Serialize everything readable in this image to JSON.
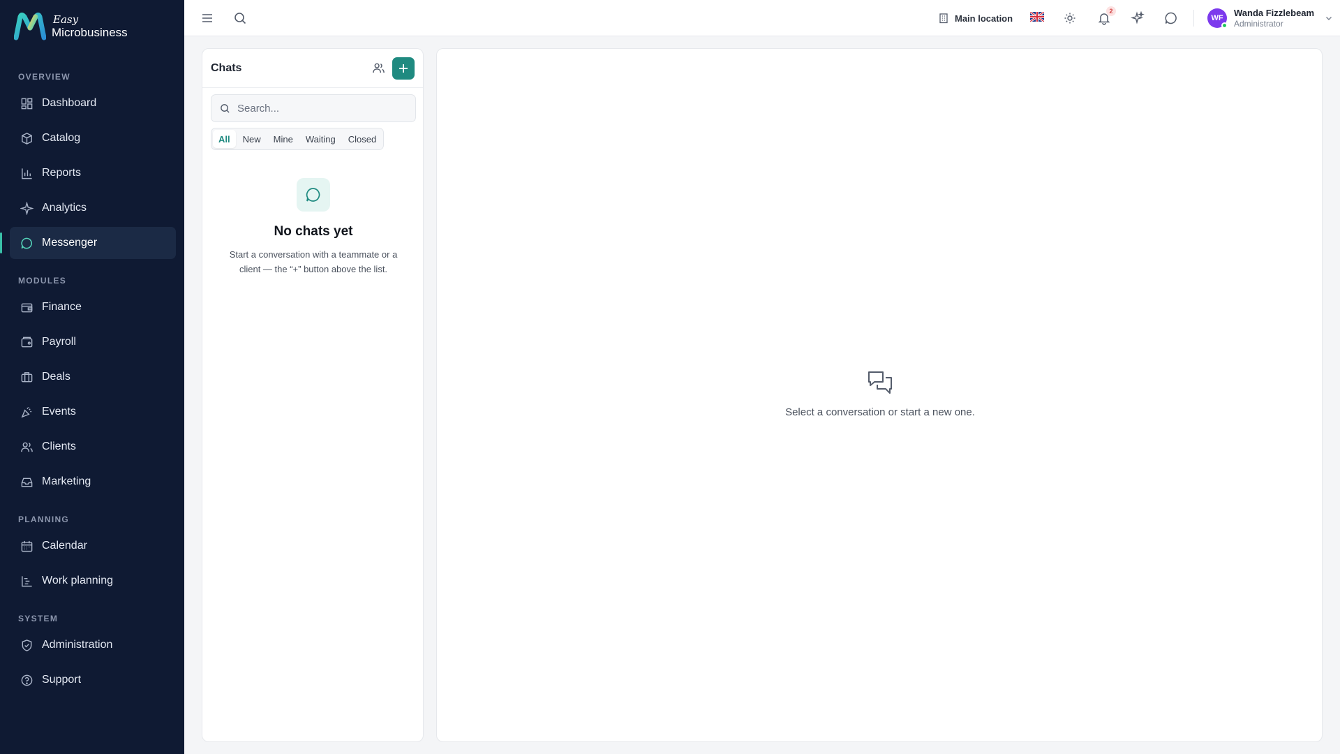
{
  "brand": {
    "easy": "Easy",
    "name": "Microbusiness"
  },
  "sidebar": {
    "sections": [
      {
        "label": "OVERVIEW"
      },
      {
        "label": "MODULES"
      },
      {
        "label": "PLANNING"
      },
      {
        "label": "SYSTEM"
      }
    ],
    "items": [
      {
        "label": "Dashboard",
        "icon": "dashboard-icon"
      },
      {
        "label": "Catalog",
        "icon": "catalog-icon"
      },
      {
        "label": "Reports",
        "icon": "reports-icon"
      },
      {
        "label": "Analytics",
        "icon": "analytics-icon"
      },
      {
        "label": "Messenger",
        "icon": "messenger-icon",
        "active": true
      },
      {
        "label": "Finance",
        "icon": "finance-icon"
      },
      {
        "label": "Payroll",
        "icon": "payroll-icon"
      },
      {
        "label": "Deals",
        "icon": "deals-icon"
      },
      {
        "label": "Events",
        "icon": "events-icon"
      },
      {
        "label": "Clients",
        "icon": "clients-icon"
      },
      {
        "label": "Marketing",
        "icon": "marketing-icon"
      },
      {
        "label": "Calendar",
        "icon": "calendar-icon"
      },
      {
        "label": "Work planning",
        "icon": "work-planning-icon"
      },
      {
        "label": "Administration",
        "icon": "administration-icon"
      },
      {
        "label": "Support",
        "icon": "support-icon"
      }
    ]
  },
  "topbar": {
    "location": "Main location",
    "language_flag": "uk-flag-icon",
    "notifications_count": "2",
    "user": {
      "initials": "WF",
      "name": "Wanda Fizzlebeam",
      "role": "Administrator"
    }
  },
  "chats": {
    "title": "Chats",
    "search_placeholder": "Search...",
    "filters": [
      "All",
      "New",
      "Mine",
      "Waiting",
      "Closed"
    ],
    "active_filter": "All",
    "empty_title": "No chats yet",
    "empty_desc": "Start a conversation with a teammate or a client — the “+” button above the list."
  },
  "conversation": {
    "placeholder": "Select a conversation or start a new one."
  },
  "colors": {
    "sidebar_bg": "#0f1a33",
    "accent": "#1f8a80",
    "active_indicator": "#39c0a8",
    "avatar_bg": "#7c3aed"
  }
}
